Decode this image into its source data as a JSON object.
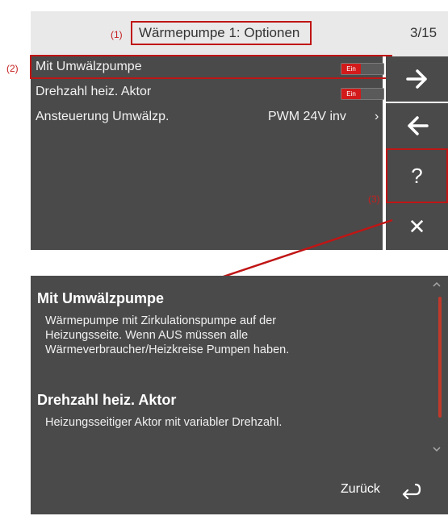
{
  "header": {
    "callout_1": "(1)",
    "title": "Wärmepumpe 1: Optionen",
    "page_count": "3/15"
  },
  "options": {
    "callout_2": "(2)",
    "rows": [
      {
        "label": "Mit Umwälzpumpe",
        "toggle": "Ein"
      },
      {
        "label": "Drehzahl heiz. Aktor",
        "toggle": "Ein"
      },
      {
        "label": "Ansteuerung Umwälzp.",
        "value": "PWM 24V inv",
        "chevron": "›"
      }
    ]
  },
  "sidebar": {
    "next_icon": "arrow-right-icon",
    "back_icon": "arrow-left-icon",
    "help_label": "?",
    "close_label": "✕",
    "callout_3": "(3)"
  },
  "help": {
    "sections": [
      {
        "title": "Mit Umwälzpumpe",
        "lines": [
          "Wärmepumpe mit Zirkulationspumpe auf der",
          "Heizungsseite. Wenn AUS müssen alle",
          "Wärmeverbraucher/Heizkreise Pumpen haben."
        ]
      },
      {
        "title": "Drehzahl heiz. Aktor",
        "lines": [
          "Heizungsseitiger Aktor mit variabler Drehzahl."
        ]
      }
    ],
    "back_label": "Zurück"
  },
  "colors": {
    "accent": "#c01515",
    "panel": "#4a4a4a",
    "toggle_on": "#d21a1a"
  }
}
